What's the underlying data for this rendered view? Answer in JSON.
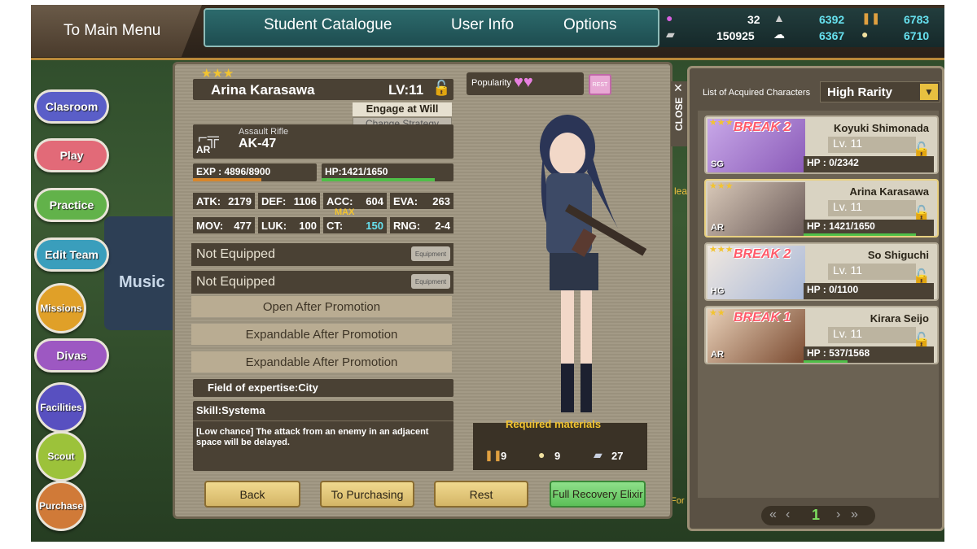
{
  "topbar": {
    "main_menu": "To Main Menu",
    "tabs": [
      "Student Catalogue",
      "User Info",
      "Options"
    ],
    "currency": {
      "players": "32",
      "coins": "150925",
      "ammo": "6392",
      "rations": "6367",
      "parts": "6783",
      "other": "6710"
    }
  },
  "sidebar": {
    "items": [
      "Clasroom",
      "Play",
      "Practice",
      "Edit Team",
      "Missions",
      "Divas",
      "Facilities",
      "Scout",
      "Purchase"
    ]
  },
  "background_text": {
    "music": "Music",
    "for": "For",
    "clear": "lea"
  },
  "detail": {
    "stars": "★★★",
    "name": "Arina Karasawa",
    "level": "LV:11",
    "popularity_label": "Popularity",
    "popularity_hearts": "♥♥",
    "rest_chip": "REST",
    "strategy": "Engage at Will",
    "change_strategy": "Change Strategy",
    "weapon_type_label": "Assault Rifle",
    "weapon_name": "AK-47",
    "weapon_badge": "AR",
    "exp_text": "EXP : 4896/8900",
    "hp_text": "HP:1421/1650",
    "exp_fraction": 0.55,
    "hp_fraction": 0.86,
    "stats": [
      {
        "k": "ATK:",
        "v": "2179"
      },
      {
        "k": "DEF:",
        "v": "1106"
      },
      {
        "k": "ACC:",
        "v": "604"
      },
      {
        "k": "EVA:",
        "v": "263"
      },
      {
        "k": "MOV:",
        "v": "477"
      },
      {
        "k": "LUK:",
        "v": "100"
      },
      {
        "k": "CT:",
        "v": "150"
      },
      {
        "k": "RNG:",
        "v": "2-4"
      }
    ],
    "ct_max": "MAX",
    "equip_slots": [
      "Not Equipped",
      "Not Equipped"
    ],
    "equip_button": "Equipment",
    "locked_slots": [
      "Open After Promotion",
      "Expandable After Promotion",
      "Expandable After Promotion"
    ],
    "field": "Field of expertise:City",
    "skill": "Skill:Systema",
    "skill_desc": "[Low chance] The attack from an enemy in an adjacent space will be delayed.",
    "required_title": "Required materials",
    "materials": [
      {
        "icon": "ammo-icon",
        "count": "9"
      },
      {
        "icon": "ration-icon",
        "count": "9"
      },
      {
        "icon": "parts-icon",
        "count": "27"
      }
    ],
    "buttons": [
      "Back",
      "To Purchasing",
      "Rest",
      "Full Recovery Elixir"
    ]
  },
  "list": {
    "close": "CLOSE",
    "title": "List of Acquired Characters",
    "filter": "High Rarity",
    "cards": [
      {
        "name": "Koyuki Shimonada",
        "lv": "Lv. 11",
        "hp": "HP : 0/2342",
        "hp_frac": 0.0,
        "stars": "★★★",
        "break": "BREAK 2",
        "weapon": "SG"
      },
      {
        "name": "Arina Karasawa",
        "lv": "Lv. 11",
        "hp": "HP : 1421/1650",
        "hp_frac": 0.86,
        "stars": "★★★",
        "break": "",
        "weapon": "AR"
      },
      {
        "name": "So Shiguchi",
        "lv": "Lv. 11",
        "hp": "HP : 0/1100",
        "hp_frac": 0.0,
        "stars": "★★★",
        "break": "BREAK 2",
        "weapon": "HG"
      },
      {
        "name": "Kirara Seijo",
        "lv": "Lv. 11",
        "hp": "HP : 537/1568",
        "hp_frac": 0.34,
        "stars": "★★",
        "break": "BREAK 1",
        "weapon": "AR"
      }
    ],
    "page": "1"
  },
  "colors": {
    "accent_gold": "#d4b566",
    "hp_green": "#4fbf48",
    "exp_orange": "#d8862a",
    "teal": "#2c6a6c"
  }
}
